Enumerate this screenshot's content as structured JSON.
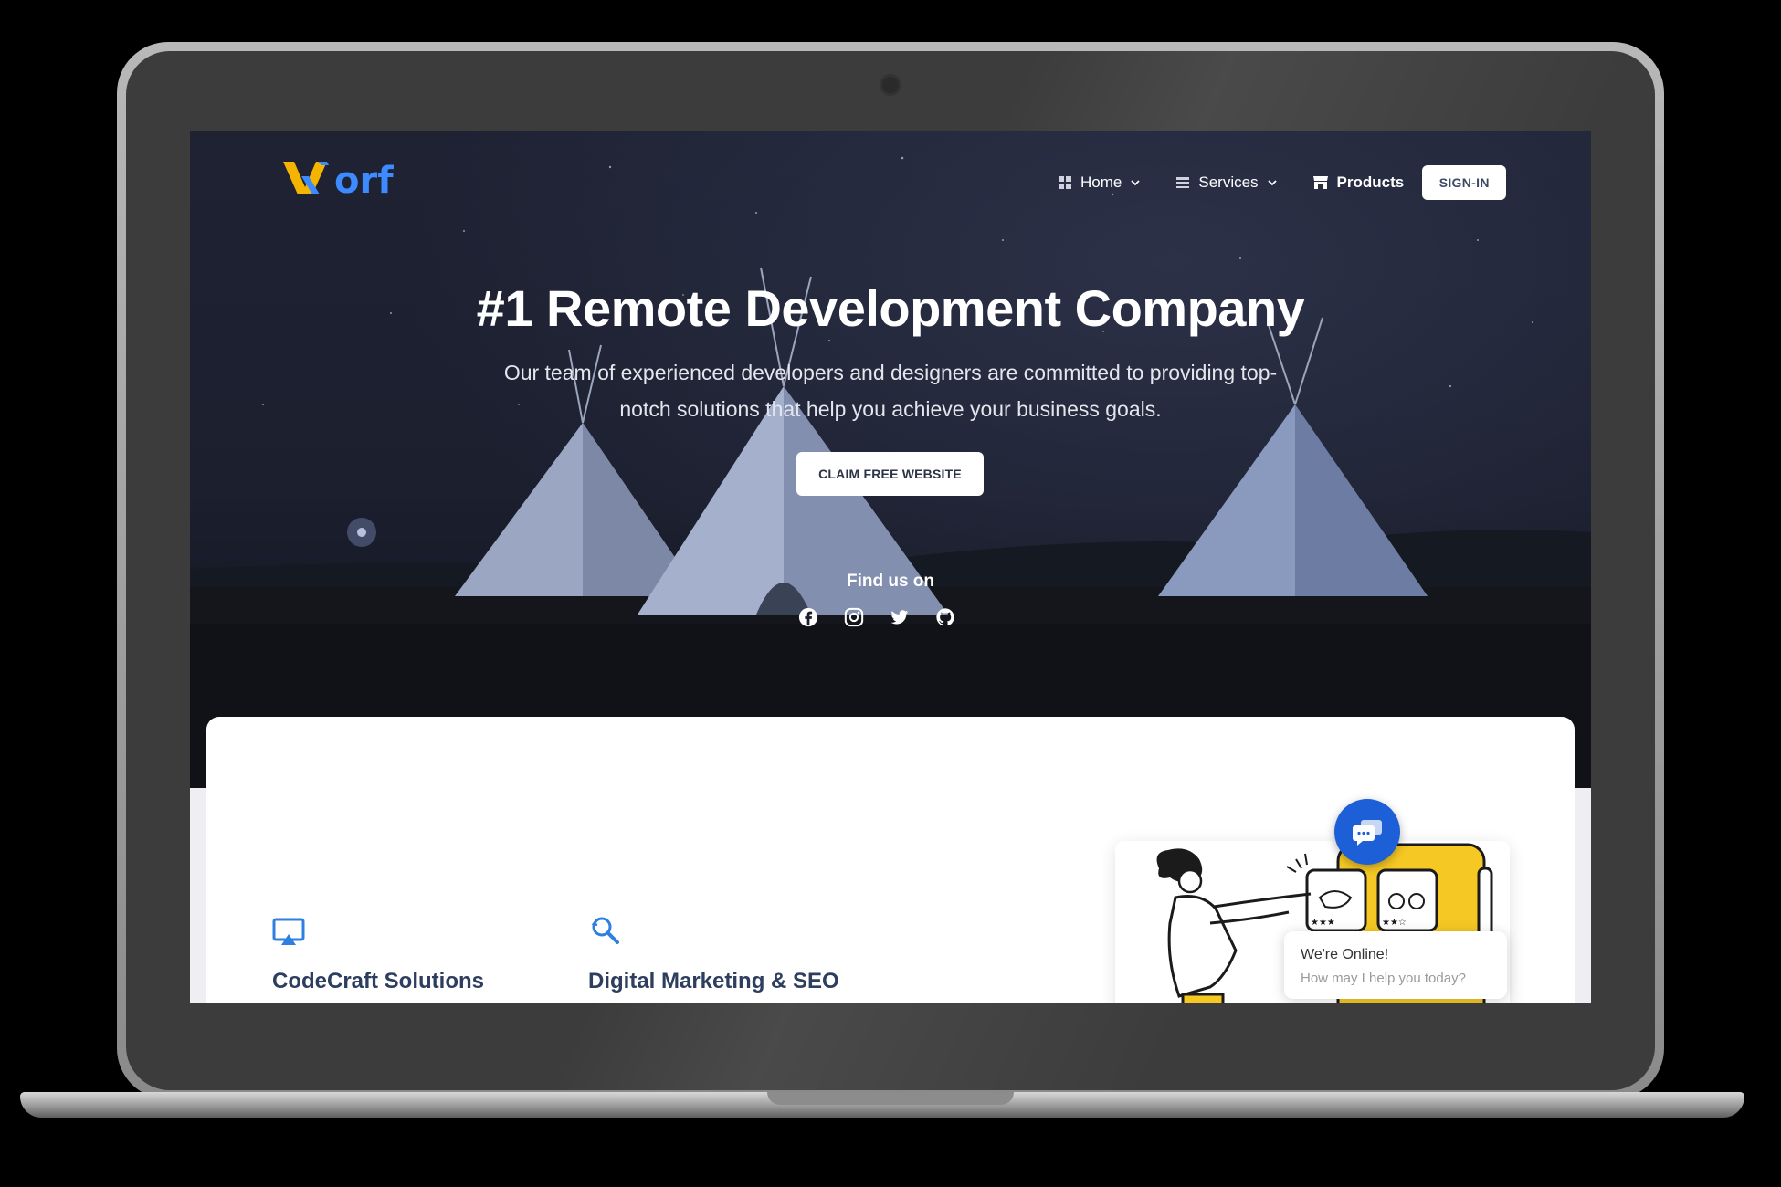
{
  "brand": {
    "logo_text_left": "VV",
    "logo_text_right": "orf",
    "logo_colors": {
      "v": "#f5b400",
      "rest": "#3d8bff"
    }
  },
  "nav": {
    "items": [
      {
        "label": "Home",
        "icon": "grid-icon",
        "dropdown": true
      },
      {
        "label": "Services",
        "icon": "list-icon",
        "dropdown": true
      },
      {
        "label": "Products",
        "icon": "store-icon",
        "dropdown": false
      }
    ],
    "signin_label": "SIGN-IN"
  },
  "hero": {
    "title": "#1 Remote Development Company",
    "subtitle_line1": "Our team of experienced developers and designers are committed to providing top-",
    "subtitle_line2": "notch solutions that help you achieve your business goals.",
    "cta_label": "CLAIM FREE WEBSITE",
    "find_us_label": "Find us on",
    "socials": [
      "facebook-icon",
      "instagram-icon",
      "twitter-icon",
      "github-icon"
    ]
  },
  "features": [
    {
      "title": "CodeCraft Solutions",
      "icon": "monitor-icon"
    },
    {
      "title": "Digital Marketing & SEO",
      "icon": "search-refresh-icon"
    }
  ],
  "chat": {
    "title": "We're Online!",
    "subtitle": "How may I help you today?",
    "accent": "#1d5fd6"
  }
}
